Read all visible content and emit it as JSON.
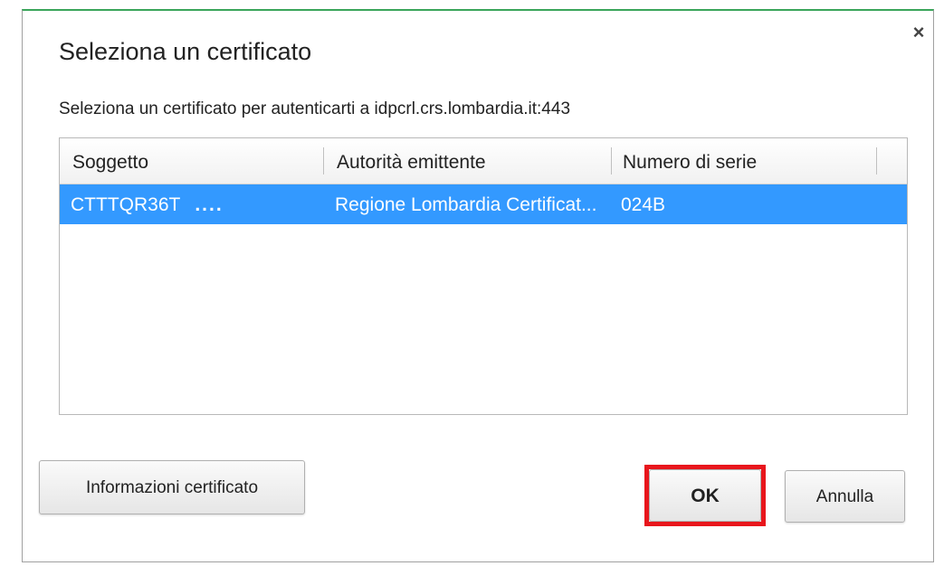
{
  "dialog": {
    "title": "Seleziona un certificato",
    "subtitle": "Seleziona un certificato per autenticarti a idpcrl.crs.lombardia.it:443",
    "close_glyph": "×",
    "close_icon": "close-icon"
  },
  "table": {
    "columns": [
      "Soggetto",
      "Autorità emittente",
      "Numero di serie"
    ],
    "rows": [
      {
        "subject": "CTTTQR36T",
        "subject_masked": "....",
        "issuer": "Regione Lombardia Certificat...",
        "serial": "024B",
        "selected": true
      }
    ]
  },
  "buttons": {
    "info_label": "Informazioni certificato",
    "ok_label": "OK",
    "cancel_label": "Annulla"
  },
  "colors": {
    "selection": "#3399ff",
    "highlight_border": "#e8161c",
    "window_accent": "#3aa55a"
  }
}
